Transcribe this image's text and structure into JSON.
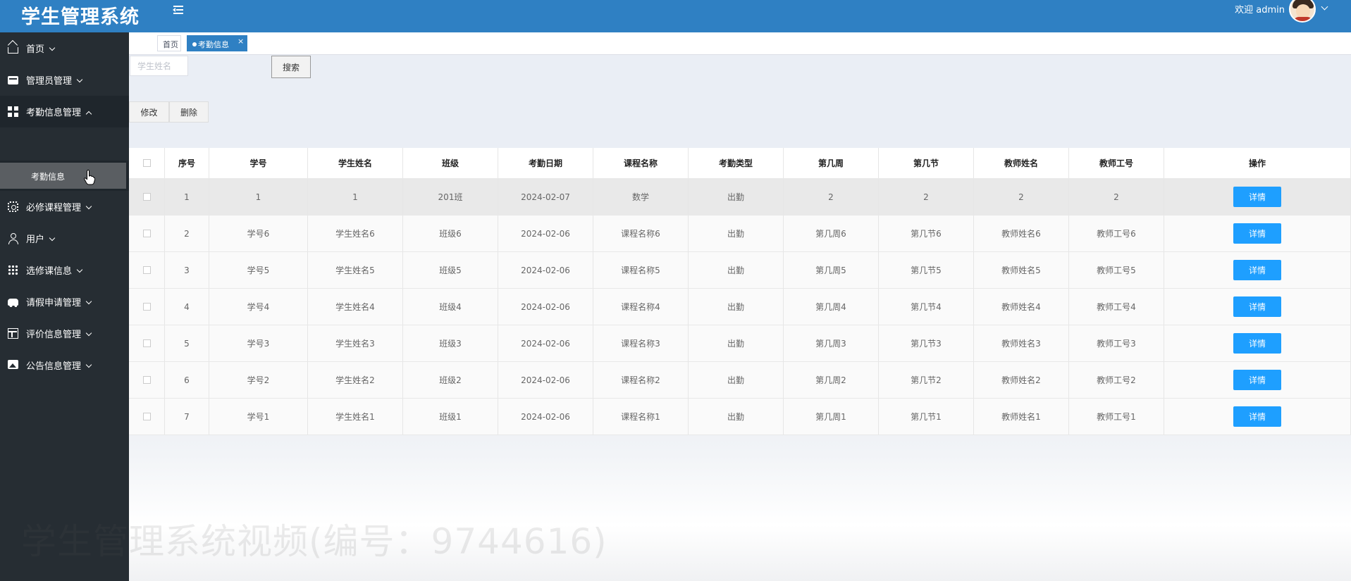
{
  "app": {
    "title": "学生管理系统",
    "welcome": "欢迎 admin"
  },
  "sidebar": {
    "items": [
      {
        "label": "首页",
        "icon": "home-icon"
      },
      {
        "label": "管理员管理",
        "icon": "card-icon"
      },
      {
        "label": "考勤信息管理",
        "icon": "grid-icon",
        "expanded": true
      },
      {
        "label": "必修课程管理",
        "icon": "cog-icon"
      },
      {
        "label": "用户",
        "icon": "user-icon"
      },
      {
        "label": "选修课信息",
        "icon": "apps-icon"
      },
      {
        "label": "请假申请管理",
        "icon": "car-icon"
      },
      {
        "label": "评价信息管理",
        "icon": "table-icon"
      },
      {
        "label": "公告信息管理",
        "icon": "picture-icon"
      }
    ],
    "subitem": "考勤信息"
  },
  "tabs": {
    "home": "首页",
    "active": "考勤信息",
    "close": "×"
  },
  "search": {
    "placeholder": "学生姓名",
    "button": "搜索"
  },
  "actions": {
    "edit": "修改",
    "delete": "删除"
  },
  "table": {
    "headers": [
      "序号",
      "学号",
      "学生姓名",
      "班级",
      "考勤日期",
      "课程名称",
      "考勤类型",
      "第几周",
      "第几节",
      "教师姓名",
      "教师工号",
      "操作"
    ],
    "rows": [
      [
        "1",
        "1",
        "1",
        "201班",
        "2024-02-07",
        "数学",
        "出勤",
        "2",
        "2",
        "2",
        "2"
      ],
      [
        "2",
        "学号6",
        "学生姓名6",
        "班级6",
        "2024-02-06",
        "课程名称6",
        "出勤",
        "第几周6",
        "第几节6",
        "教师姓名6",
        "教师工号6"
      ],
      [
        "3",
        "学号5",
        "学生姓名5",
        "班级5",
        "2024-02-06",
        "课程名称5",
        "出勤",
        "第几周5",
        "第几节5",
        "教师姓名5",
        "教师工号5"
      ],
      [
        "4",
        "学号4",
        "学生姓名4",
        "班级4",
        "2024-02-06",
        "课程名称4",
        "出勤",
        "第几周4",
        "第几节4",
        "教师姓名4",
        "教师工号4"
      ],
      [
        "5",
        "学号3",
        "学生姓名3",
        "班级3",
        "2024-02-06",
        "课程名称3",
        "出勤",
        "第几周3",
        "第几节3",
        "教师姓名3",
        "教师工号3"
      ],
      [
        "6",
        "学号2",
        "学生姓名2",
        "班级2",
        "2024-02-06",
        "课程名称2",
        "出勤",
        "第几周2",
        "第几节2",
        "教师姓名2",
        "教师工号2"
      ],
      [
        "7",
        "学号1",
        "学生姓名1",
        "班级1",
        "2024-02-06",
        "课程名称1",
        "出勤",
        "第几周1",
        "第几节1",
        "教师姓名1",
        "教师工号1"
      ]
    ],
    "detail_label": "详情"
  },
  "watermark": "学生管理系统视频(编号：9744616)",
  "colors": {
    "header": "#2f80c3",
    "sidebar": "#262d33",
    "primary_button": "#1e9fff"
  }
}
